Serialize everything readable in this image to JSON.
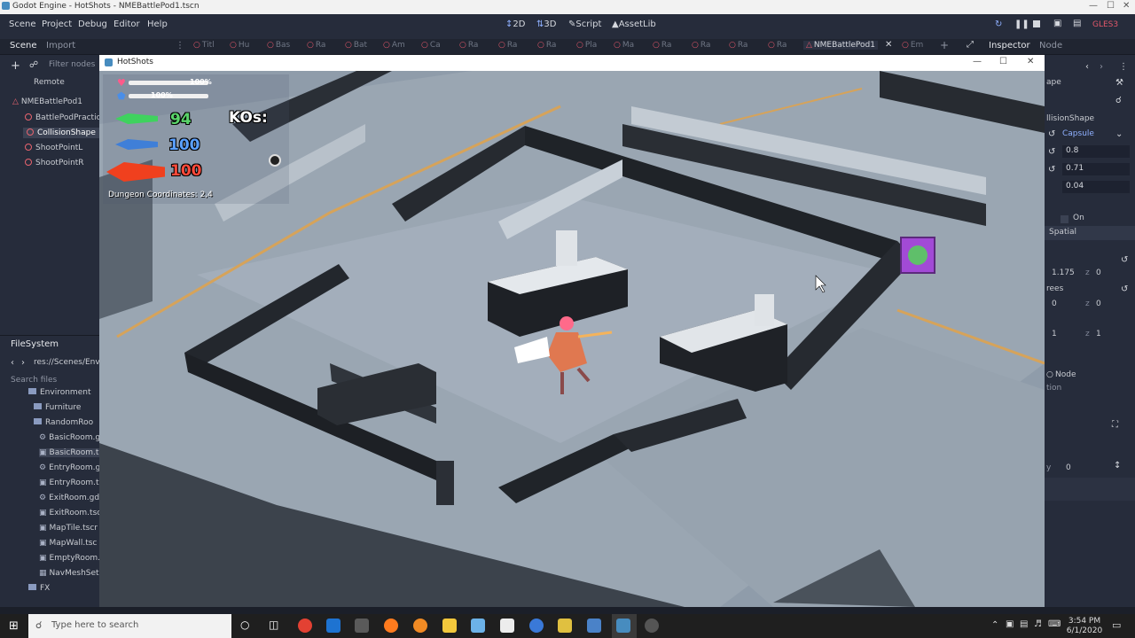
{
  "window": {
    "title": "Godot Engine - HotShots - NMEBattlePod1.tscn"
  },
  "menu": {
    "items": [
      "Scene",
      "Project",
      "Debug",
      "Editor",
      "Help"
    ]
  },
  "workspaces": {
    "btn_2d": "2D",
    "btn_3d": "3D",
    "btn_script": "Script",
    "btn_assetlib": "AssetLib"
  },
  "renderer": {
    "label": "GLES3"
  },
  "docks": {
    "scene": "Scene",
    "import": "Import",
    "inspector": "Inspector",
    "node": "Node",
    "filter_placeholder": "Filter nodes",
    "remote": "Remote"
  },
  "scene_tabs": [
    "Titl",
    "Hu",
    "Bas",
    "Ra",
    "Bat",
    "Am",
    "Ca",
    "Ra",
    "Ra",
    "Ra",
    "Pla",
    "Ma",
    "Ra",
    "Ra",
    "Ra",
    "Ra"
  ],
  "current_tab": "NMEBattlePod1",
  "last_tab": "Em",
  "scene_tree": {
    "root": "NMEBattlePod1",
    "children": [
      "BattlePodPractic",
      "CollisionShape",
      "ShootPointL",
      "ShootPointR"
    ],
    "selected": "CollisionShape"
  },
  "filesystem": {
    "title": "FileSystem",
    "path": "res://Scenes/Env",
    "search_placeholder": "Search files",
    "items": [
      {
        "name": "Environment",
        "type": "folder"
      },
      {
        "name": "Furniture",
        "type": "folder"
      },
      {
        "name": "RandomRoo",
        "type": "folder"
      },
      {
        "name": "BasicRoom.g",
        "type": "file"
      },
      {
        "name": "BasicRoom.t",
        "type": "file"
      },
      {
        "name": "EntryRoom.g",
        "type": "file"
      },
      {
        "name": "EntryRoom.t",
        "type": "file"
      },
      {
        "name": "ExitRoom.gd",
        "type": "file"
      },
      {
        "name": "ExitRoom.tsc",
        "type": "file"
      },
      {
        "name": "MapTile.tscr",
        "type": "file"
      },
      {
        "name": "MapWall.tsc",
        "type": "file"
      },
      {
        "name": "EmptyRoom.",
        "type": "file"
      },
      {
        "name": "NavMeshSet",
        "type": "file"
      },
      {
        "name": "FX",
        "type": "folder"
      }
    ]
  },
  "inspector": {
    "header": "ape",
    "shape_label": "llisionShape",
    "shape_value": "Capsule",
    "radius": "0.8",
    "height": "0.71",
    "margin": "0.04",
    "toggle": "On",
    "section": "Spatial",
    "transform_x": "1.175",
    "transform_z": "0",
    "rotation_label": "rees",
    "rotation_x": "0",
    "rotation_z": "0",
    "scale_x": "1",
    "scale_z": "1",
    "node_label": "Node",
    "tion_label": "tion",
    "y_label": "y",
    "y_value": "0"
  },
  "game": {
    "window_title": "HotShots",
    "health_pct": "100%",
    "shield_pct": "100%",
    "ammo_green": "94",
    "ammo_blue": "100",
    "ammo_red": "100",
    "kos_label": "KOs:",
    "coords": "Dungeon Coordinates: 2,4",
    "health": 1.0,
    "shield": 1.0
  },
  "taskbar": {
    "search_placeholder": "Type here to search",
    "time": "3:54 PM",
    "date": "6/1/2020"
  },
  "colors": {
    "editor_bg": "#202531",
    "panel": "#262c3b",
    "accent": "#6e8cff",
    "node_ring": "#e8646f"
  }
}
